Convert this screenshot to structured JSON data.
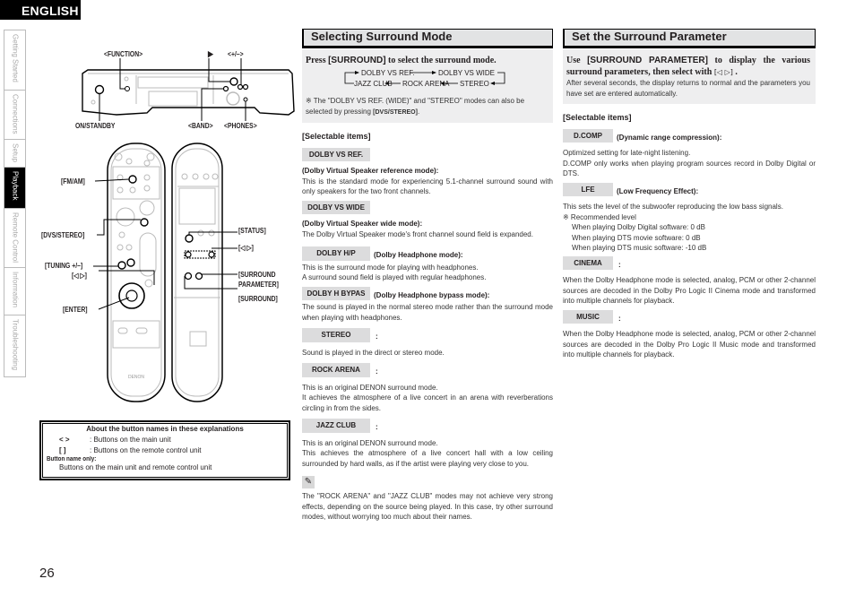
{
  "language_tab": "ENGLISH",
  "side_nav": [
    {
      "label": "Getting Started",
      "active": false
    },
    {
      "label": "Connections",
      "active": false
    },
    {
      "label": "Setup",
      "active": false
    },
    {
      "label": "Playback",
      "active": true
    },
    {
      "label": "Remote Control",
      "active": false
    },
    {
      "label": "Information",
      "active": false
    },
    {
      "label": "Troubleshooting",
      "active": false
    }
  ],
  "diagram": {
    "main_unit_labels": {
      "function": "<FUNCTION>",
      "play": "▶",
      "plus_minus": "<+/–>",
      "on_standby": "ON/STANDBY",
      "band": "<BAND>",
      "phones": "<PHONES>"
    },
    "remote_labels": {
      "fm_am": "[FM/AM]",
      "dvs_stereo": "[DVS/STEREO]",
      "tuning": "[TUNING +/–]",
      "cursor_left_right": "[◁ ▷]",
      "enter": "[ENTER]",
      "status": "[STATUS]",
      "cursor_left_right_2": "[◁ ▷]",
      "surround_parameter_1": "[SURROUND",
      "surround_parameter_2": "PARAMETER]",
      "surround": "[SURROUND]"
    },
    "brand": "DENON"
  },
  "legend": {
    "title": "About the button names in these explanations",
    "rows": [
      {
        "symbol": "<   >",
        "text": ": Buttons on the main unit"
      },
      {
        "symbol": "[    ]",
        "text": ": Buttons on the remote control unit"
      }
    ],
    "subhead": "Button name only:",
    "desc": "Buttons on the main unit and remote control unit"
  },
  "page_number": "26",
  "selecting": {
    "title": "Selecting Surround Mode",
    "press_pre": "Press ",
    "press_btn": "[SURROUND]",
    "press_post": " to select the surround mode.",
    "cycle": {
      "a": "DOLBY VS REF.",
      "b": "DOLBY VS WIDE",
      "c": "STEREO",
      "d": "ROCK ARENA",
      "e": "JAZZ CLUB"
    },
    "note_pre": "※ The \"DOLBY VS REF. (WIDE)\" and \"STEREO\" modes can also be selected by pressing ",
    "note_btn": "[DVS/STEREO]",
    "note_post": ".",
    "selectable_head": "[Selectable items]",
    "items": [
      {
        "tag": "DOLBY VS REF.",
        "sub": "(Dolby Virtual Speaker reference mode):",
        "body": [
          "This is the standard mode for experiencing 5.1-channel surround sound with only speakers for the two front channels."
        ]
      },
      {
        "tag": "DOLBY VS WIDE",
        "sub": "(Dolby Virtual Speaker wide mode):",
        "body": [
          "The Dolby Virtual Speaker mode's front channel sound field is expanded."
        ]
      },
      {
        "tag": "DOLBY H/P",
        "sub": "(Dolby Headphone mode):",
        "body": [
          "This is the surround mode for playing with headphones.",
          "A surround sound field is played with regular headphones."
        ]
      },
      {
        "tag": "DOLBY H BYPAS",
        "sub": "(Dolby Headphone bypass mode):",
        "body": [
          "The sound is played in the normal stereo mode rather than the surround mode when playing with headphones."
        ]
      },
      {
        "tag": "STEREO",
        "sub": ":",
        "body": [
          "Sound is played in the direct or stereo mode."
        ]
      },
      {
        "tag": "ROCK ARENA",
        "sub": ":",
        "body": [
          "This is an original DENON surround mode.",
          "It achieves the atmosphere of a live concert in an arena with reverberations circling in from the sides."
        ]
      },
      {
        "tag": "JAZZ CLUB",
        "sub": ":",
        "body": [
          "This is an original DENON surround mode.",
          "This achieves the atmosphere of a live concert hall with a low ceiling surrounded by hard walls, as if the artist were playing very close to you."
        ]
      }
    ],
    "tip_icon": "pencil-icon",
    "tip": "The \"ROCK ARENA\" and \"JAZZ CLUB\" modes may not achieve very strong effects, depending on the source being played. In this case, try other surround modes, without worrying too much about their names."
  },
  "parameter": {
    "title": "Set the Surround Parameter",
    "use_pre": "Use ",
    "use_btn": "[SURROUND PARAMETER]",
    "use_post": " to display the various surround parameters, then select with ",
    "use_btn2": "[◁ ▷]",
    "use_end": " .",
    "intro": "After several seconds, the display returns to normal and the parameters you have set are entered automatically.",
    "selectable_head": "[Selectable items]",
    "items": [
      {
        "tag": "D.COMP",
        "sub": "(Dynamic range compression):",
        "body": [
          "Optimized setting for late-night listening.",
          "D.COMP only works when playing program sources record in Dolby Digital or DTS."
        ]
      },
      {
        "tag": "LFE",
        "sub": "(Low Frequency Effect):",
        "body": [
          "This sets the level of the subwoofer reproducing the low bass signals."
        ],
        "extra_head": "※ Recommended level",
        "extra": [
          "When playing Dolby Digital software: 0 dB",
          "When playing DTS movie software: 0 dB",
          "When playing DTS music software: -10 dB"
        ]
      },
      {
        "tag": "CINEMA",
        "sub": ":",
        "body": [
          "When the Dolby Headphone mode is selected, analog, PCM or other 2-channel sources are decoded in the Dolby Pro Logic II Cinema mode and transformed into multiple channels for playback."
        ]
      },
      {
        "tag": "MUSIC",
        "sub": ":",
        "body": [
          "When the Dolby Headphone mode is selected, analog, PCM or other 2-channel sources are decoded in the Dolby Pro Logic II Music mode and transformed into multiple channels for playback."
        ]
      }
    ]
  }
}
